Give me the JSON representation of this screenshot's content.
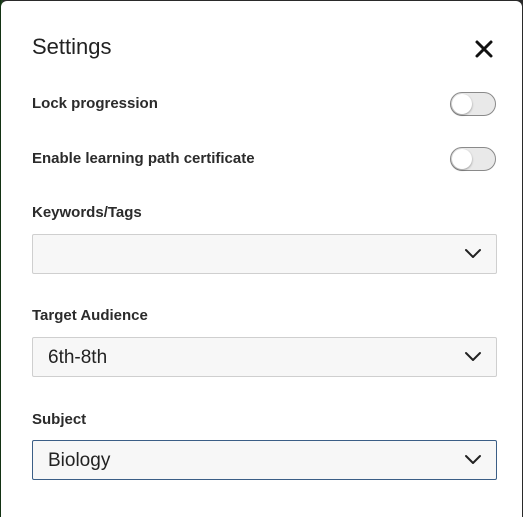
{
  "dialog": {
    "title": "Settings",
    "close_icon": "close-icon"
  },
  "toggles": [
    {
      "label": "Lock progression",
      "checked": false
    },
    {
      "label": "Enable learning path certificate",
      "checked": false
    }
  ],
  "fields": {
    "keywords": {
      "label": "Keywords/Tags",
      "value": ""
    },
    "audience": {
      "label": "Target Audience",
      "value": "6th-8th"
    },
    "subject": {
      "label": "Subject",
      "value": "Biology"
    }
  },
  "icons": {
    "chevron": "chevron-down-icon",
    "close": "close-icon"
  },
  "colors": {
    "focus_border": "#3b5e86",
    "toggle_track": "#e9e9e9"
  }
}
